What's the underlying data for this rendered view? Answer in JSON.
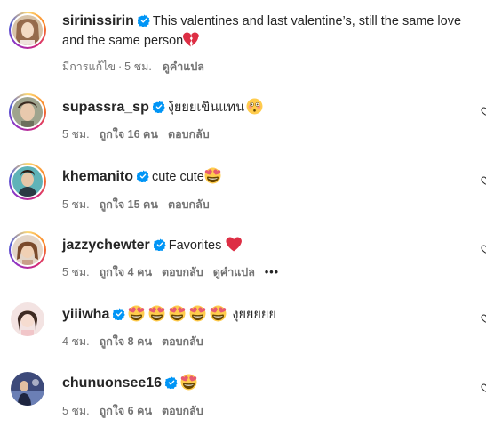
{
  "comments": [
    {
      "username": "sirinissirin",
      "text": "This valentines and last valentine’s, still the same love and the same person",
      "edited_label": "มีการแก้ไข",
      "sep": "·",
      "time": "5 ชม.",
      "translate_label": "ดูคำแปล"
    },
    {
      "username": "supassra_sp",
      "text": "งุ้ยยยเขินแทน",
      "time": "5 ชม.",
      "likes_label": "ถูกใจ 16 คน",
      "reply_label": "ตอบกลับ"
    },
    {
      "username": "khemanito",
      "text": "cute cute",
      "time": "5 ชม.",
      "likes_label": "ถูกใจ 15 คน",
      "reply_label": "ตอบกลับ"
    },
    {
      "username": "jazzychewter",
      "text": "Favorites",
      "time": "5 ชม.",
      "likes_label": "ถูกใจ 4 คน",
      "reply_label": "ตอบกลับ",
      "translate_label": "ดูคำแปล",
      "more_label": "•••"
    },
    {
      "username": "yiiiwha",
      "text": "งุยยยยย",
      "time": "4 ชม.",
      "likes_label": "ถูกใจ 8 คน",
      "reply_label": "ตอบกลับ"
    },
    {
      "username": "chunuonsee16",
      "text": "",
      "time": "5 ชม.",
      "likes_label": "ถูกใจ 6 คน",
      "reply_label": "ตอบกลับ"
    }
  ],
  "icons": {
    "verified": "verified-badge-icon",
    "like": "heart-outline-icon",
    "heart_eyes": "heart-eyes-emoji",
    "flushed": "flushed-face-emoji",
    "red_heart": "red-heart-emoji",
    "broken_heart": "broken-heart-emoji"
  },
  "colors": {
    "verified": "#0095f6",
    "meta_text": "#737373",
    "text": "#262626"
  }
}
